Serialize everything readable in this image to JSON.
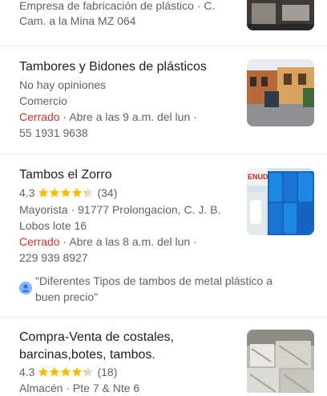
{
  "colors": {
    "closed": "#d93025",
    "star": "#fbbc04",
    "text_secondary": "#5f6368",
    "divider": "#e8eaed"
  },
  "results": [
    {
      "lines": [
        "Empresa de fabricación de plástico · C.",
        "Cam. a la Mina MZ 064"
      ]
    },
    {
      "name": "Tambores y Bidones de plásticos",
      "reviews": "No hay opiniones",
      "category": "Comercio",
      "status": "Cerrado",
      "hours": " · Abre a las 9 a.m. del lun ·",
      "phone": "55 1931 9638"
    },
    {
      "name": "Tambos el Zorro",
      "rating": "4.3",
      "stars": 4.3,
      "review_count": "(34)",
      "address_line1": "Mayorista · 91777 Prolongacion, C. J. B.",
      "address_line2": "Lobos lote 16",
      "status": "Cerrado",
      "hours": " · Abre a las 8 a.m. del lun ·",
      "phone": "229 939 8927",
      "review_line1": "\"Diferentes Tipos de tambos de metal plástico a",
      "review_line2": "buen precio\"",
      "thumb_sign": "ENUDE"
    },
    {
      "name_line1": "Compra-Venta de costales,",
      "name_line2": "barcinas,botes, tambos.",
      "rating": "4.3",
      "stars": 4.3,
      "review_count": "(18)",
      "address": "Almacén · Pte 7 & Nte 6"
    }
  ]
}
